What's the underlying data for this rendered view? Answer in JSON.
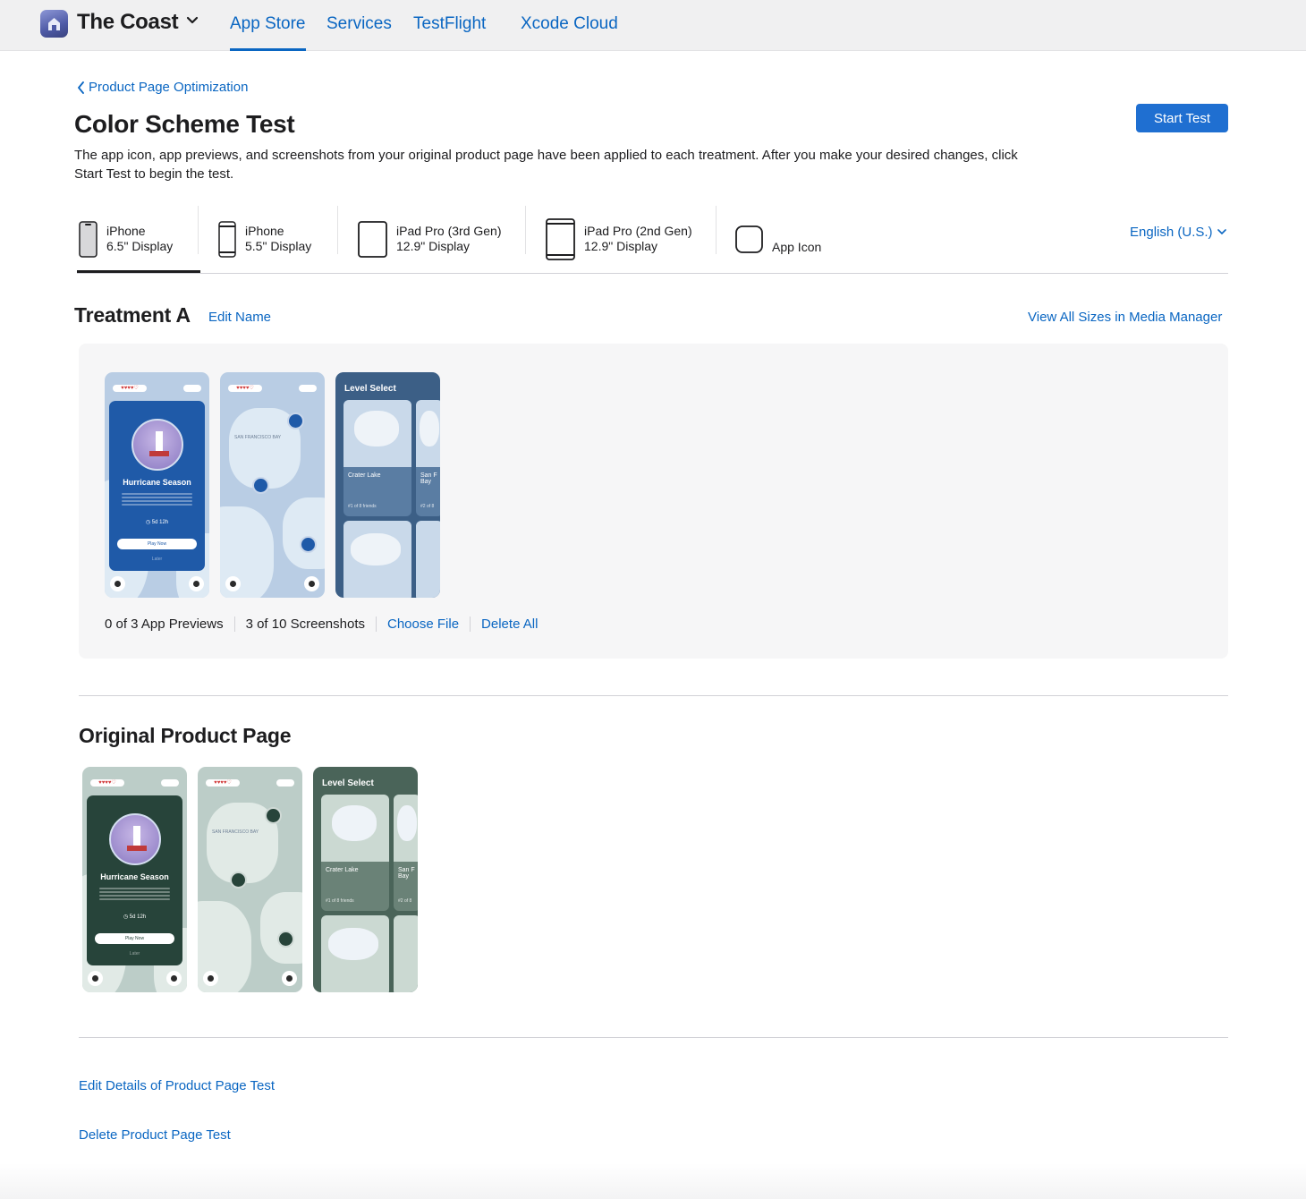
{
  "header": {
    "app_name": "The Coast",
    "tabs": [
      "App Store",
      "Services",
      "TestFlight",
      "Xcode Cloud"
    ],
    "active_tab": "App Store"
  },
  "breadcrumb": {
    "back_label": "Product Page Optimization"
  },
  "page": {
    "title": "Color Scheme Test",
    "description": "The app icon, app previews, and screenshots from your original product page have been applied to each treatment. After you make your desired changes, click Start Test to begin the test.",
    "start_button": "Start Test"
  },
  "device_tabs": [
    {
      "line1": "iPhone",
      "line2": "6.5\" Display",
      "icon": "iphone-icon",
      "selected": true
    },
    {
      "line1": "iPhone",
      "line2": "5.5\" Display",
      "icon": "iphone-icon",
      "selected": false
    },
    {
      "line1": "iPad Pro (3rd Gen)",
      "line2": "12.9\" Display",
      "icon": "ipad-icon",
      "selected": false
    },
    {
      "line1": "iPad Pro (2nd Gen)",
      "line2": "12.9\" Display",
      "icon": "ipad-icon",
      "selected": false
    },
    {
      "line1": "",
      "line2": "App Icon",
      "icon": "app-icon-outline",
      "selected": false
    }
  ],
  "language": "English (U.S.)",
  "treatment": {
    "title": "Treatment A",
    "edit_name": "Edit Name",
    "view_all": "View All Sizes in Media Manager",
    "previews_count": "0 of 3 App Previews",
    "screenshots_count": "3  of 10 Screenshots",
    "choose_file": "Choose File",
    "delete_all": "Delete All",
    "accent": "#1f5aa8"
  },
  "original": {
    "title": "Original Product Page",
    "accent": "#27443a"
  },
  "screens": {
    "card_title": "Hurricane Season",
    "timer": "◷ 5d 12h",
    "play": "Play Now",
    "later": "Later",
    "map_label": "SAN FRANCISCO BAY",
    "level_title": "Level Select",
    "tile1_name": "Crater Lake",
    "tile1_rank": "#1 of 8 friends",
    "tile2_name": "San F Bay",
    "tile2_rank": "#2 of 8"
  },
  "footer": {
    "edit_details": "Edit Details of Product Page Test",
    "delete_test": "Delete Product Page Test"
  }
}
